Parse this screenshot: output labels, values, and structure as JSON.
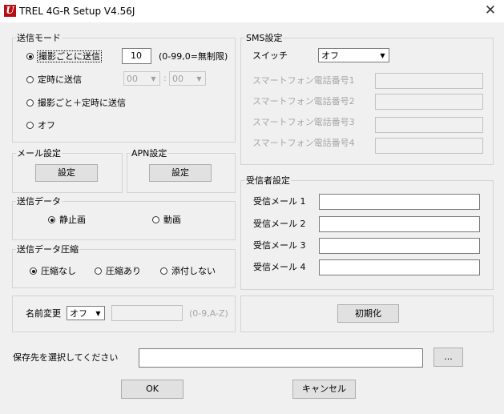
{
  "window": {
    "title": "TREL 4G-R Setup V4.56J",
    "icon_letter": "U"
  },
  "send_mode": {
    "legend": "送信モード",
    "options": [
      {
        "label": "撮影ごとに送信",
        "selected": true
      },
      {
        "label": "定時に送信",
        "selected": false
      },
      {
        "label": "撮影ごと＋定時に送信",
        "selected": false
      },
      {
        "label": "オフ",
        "selected": false
      }
    ],
    "count_value": "10",
    "count_hint": "(0-99,0=無制限)",
    "time_hour": "00",
    "time_sep": ":",
    "time_minute": "00"
  },
  "mail_settings": {
    "legend": "メール設定",
    "button": "設定"
  },
  "apn_settings": {
    "legend": "APN設定",
    "button": "設定"
  },
  "send_data": {
    "legend": "送信データ",
    "options": [
      {
        "label": "静止画",
        "selected": true
      },
      {
        "label": "動画",
        "selected": false
      }
    ]
  },
  "compression": {
    "legend": "送信データ圧縮",
    "options": [
      {
        "label": "圧縮なし",
        "selected": true
      },
      {
        "label": "圧縮あり",
        "selected": false
      },
      {
        "label": "添付しない",
        "selected": false
      }
    ]
  },
  "rename": {
    "label": "名前変更",
    "select_value": "オフ",
    "name_value": "",
    "hint": "(0-9,A-Z)"
  },
  "sms": {
    "legend": "SMS設定",
    "switch_label": "スイッチ",
    "switch_value": "オフ",
    "phones": [
      {
        "label": "スマートフォン電話番号1",
        "value": ""
      },
      {
        "label": "スマートフォン電話番号2",
        "value": ""
      },
      {
        "label": "スマートフォン電話番号3",
        "value": ""
      },
      {
        "label": "スマートフォン電話番号4",
        "value": ""
      }
    ]
  },
  "recipients": {
    "legend": "受信者設定",
    "mails": [
      {
        "label": "受信メール 1",
        "value": ""
      },
      {
        "label": "受信メール 2",
        "value": ""
      },
      {
        "label": "受信メール 3",
        "value": ""
      },
      {
        "label": "受信メール 4",
        "value": ""
      }
    ]
  },
  "initialize_button": "初期化",
  "save_path": {
    "label": "保存先を選択してください",
    "value": "",
    "browse_button": "..."
  },
  "footer": {
    "ok": "OK",
    "cancel": "キャンセル"
  }
}
